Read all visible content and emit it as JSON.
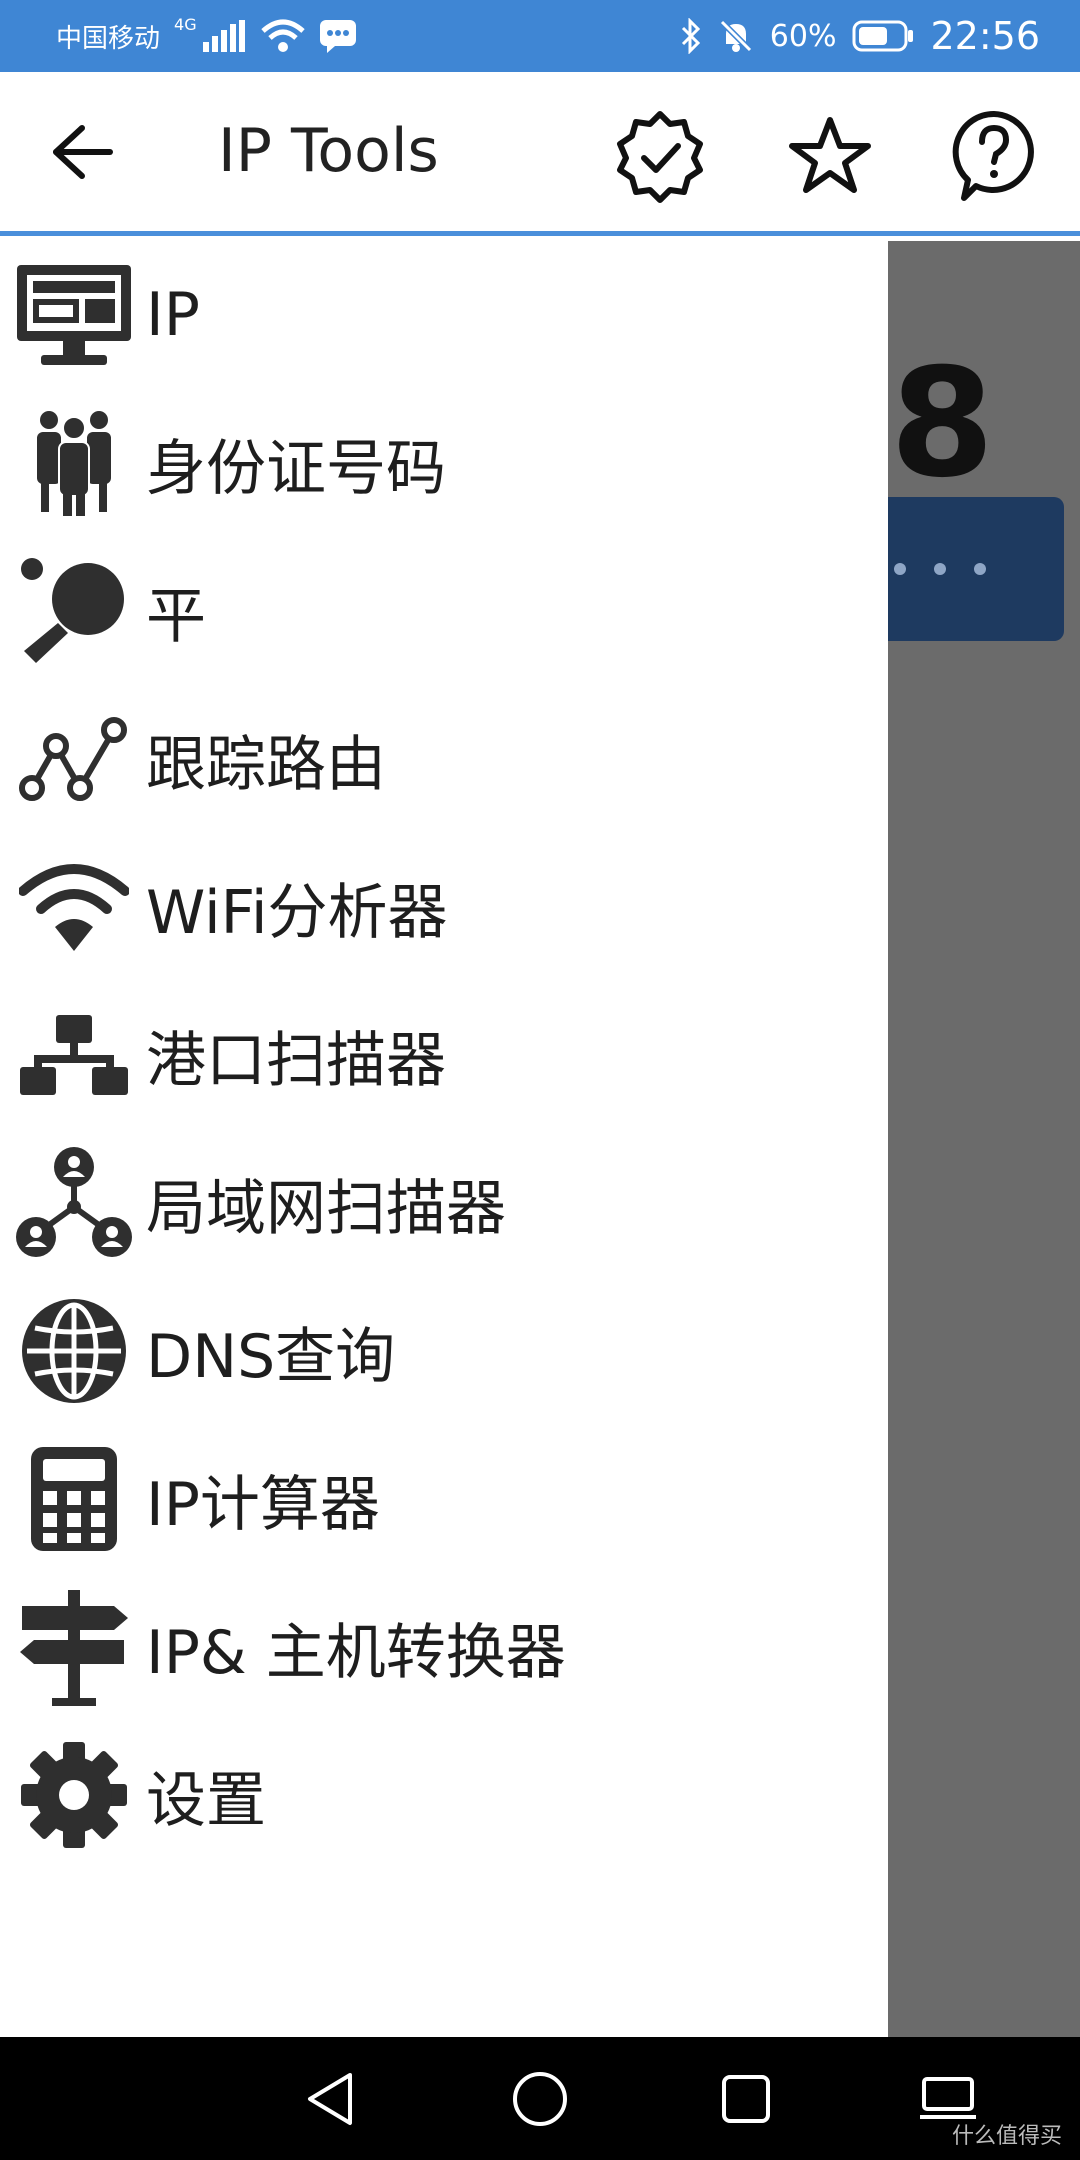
{
  "status_bar": {
    "carrier": "中国移动",
    "network": "4G",
    "battery": "60%",
    "time": "22:56"
  },
  "app_bar": {
    "title": "IP Tools"
  },
  "underlying": {
    "ip_tail": "8"
  },
  "menu": [
    {
      "label": "IP",
      "icon": "monitor-icon"
    },
    {
      "label": "身份证号码",
      "icon": "people-icon"
    },
    {
      "label": "平",
      "icon": "ping-pong-icon"
    },
    {
      "label": "跟踪路由",
      "icon": "route-icon"
    },
    {
      "label": "WiFi分析器",
      "icon": "wifi-icon"
    },
    {
      "label": "港口扫描器",
      "icon": "network-diagram-icon"
    },
    {
      "label": "局域网扫描器",
      "icon": "lan-users-icon"
    },
    {
      "label": "DNS查询",
      "icon": "globe-icon"
    },
    {
      "label": "IP计算器",
      "icon": "calculator-icon"
    },
    {
      "label": "IP& 主机转换器",
      "icon": "signpost-icon"
    },
    {
      "label": "设置",
      "icon": "gear-icon"
    }
  ],
  "watermark": "什么值得买"
}
